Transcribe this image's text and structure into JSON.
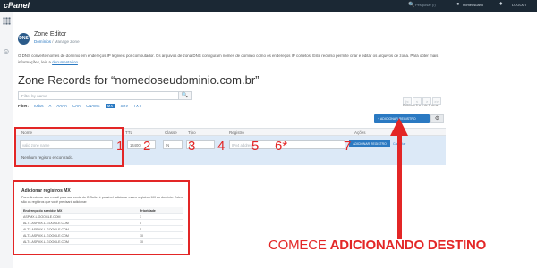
{
  "topbar": {
    "logo": "cPanel",
    "search_placeholder": "Pesquisar (/)",
    "user": "nomeusuario",
    "logout": "LOGOUT"
  },
  "header": {
    "title": "Zone Editor",
    "breadcrumb": [
      "Domínios",
      "Manage Zone"
    ],
    "app_icon_text": "DNS"
  },
  "description": {
    "text": "O DNS converte nomes de domínio em endereços IP legíveis por computador. Os arquivos de zona DNS configuram nomes de domínio como os endereços IP corretos. Este recurso permite criar e editar os arquivos de zona. Para obter mais informações, leia a",
    "link": "documentation"
  },
  "records": {
    "title": "Zone Records for “nomedoseudominio.com.br”",
    "filter_placeholder": "Filter by name",
    "filter_label": "Filter:",
    "filter_options": [
      "Todos",
      "A",
      "AAAA",
      "CAA",
      "CNAME",
      "MX",
      "SRV",
      "TXT"
    ],
    "filter_active": "MX",
    "pager": [
      "|<",
      "<",
      ">",
      ">>|"
    ],
    "pager_info": "Exibindo 0 a 0 de 0 itens",
    "add_button": "+ ADICIONAR REGISTRO",
    "columns": [
      "Nome",
      "TTL",
      "Classe",
      "Tipo",
      "Registro",
      "Ações"
    ],
    "edit_row": {
      "name_placeholder": "valid zone name",
      "ttl": "14400",
      "class": "IN",
      "type": "A",
      "record_placeholder": "IPv4 address",
      "save": "ADICIONAR REGISTRO",
      "cancel": "Cancelar"
    },
    "empty_message": "Nenhum registro encontrado."
  },
  "annotations": {
    "numbers": [
      "1",
      "2",
      "3",
      "4",
      "5",
      "6*",
      "7"
    ],
    "cta_prefix": "COMECE ",
    "cta_strong": "ADICIONANDO DESTINO",
    "accent": "#e32626"
  },
  "mx_panel": {
    "title": "Adicionar registros MX",
    "desc": "Para direcionar seu e-mail para sua conta do G Suite, é possível adicionar esses registros MX ao domínio. Estes são os registros que você precisará adicionar:",
    "headers": [
      "Endereço do servidor MX",
      "Prioridade"
    ],
    "rows": [
      [
        "ASPMX.L.GOOGLE.COM",
        "1"
      ],
      [
        "ALT1.ASPMX.L.GOOGLE.COM",
        "5"
      ],
      [
        "ALT2.ASPMX.L.GOOGLE.COM",
        "5"
      ],
      [
        "ALT3.ASPMX.L.GOOGLE.COM",
        "10"
      ],
      [
        "ALT4.ASPMX.L.GOOGLE.COM",
        "10"
      ]
    ]
  },
  "colors": {
    "topbar": "#1b2834",
    "primary": "#2a79c2",
    "edit_row": "#dce9f7"
  }
}
